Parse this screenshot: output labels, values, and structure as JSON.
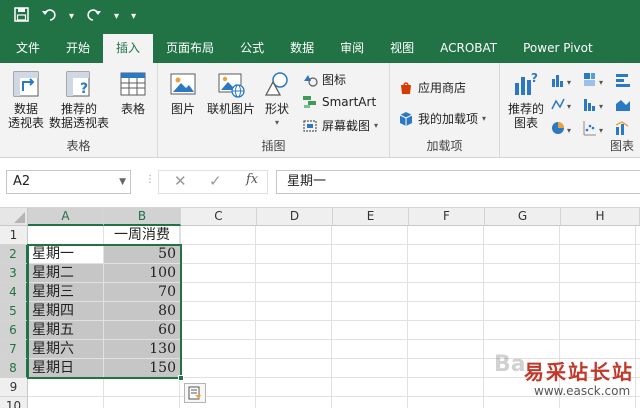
{
  "quick_access": {
    "save_icon": "save-icon",
    "undo_icon": "undo-icon",
    "redo_icon": "redo-icon",
    "customize_icon": "customize-quick-access-icon"
  },
  "tabs": [
    {
      "label": "文件",
      "active": false
    },
    {
      "label": "开始",
      "active": false
    },
    {
      "label": "插入",
      "active": true
    },
    {
      "label": "页面布局",
      "active": false
    },
    {
      "label": "公式",
      "active": false
    },
    {
      "label": "数据",
      "active": false
    },
    {
      "label": "审阅",
      "active": false
    },
    {
      "label": "视图",
      "active": false
    },
    {
      "label": "ACROBAT",
      "active": false
    },
    {
      "label": "Power Pivot",
      "active": false
    }
  ],
  "ribbon": {
    "tables": {
      "label": "表格",
      "pivot_table": {
        "line1": "数据",
        "line2": "透视表"
      },
      "recommended_pivot": {
        "line1": "推荐的",
        "line2": "数据透视表"
      },
      "table": {
        "line1": "表格"
      }
    },
    "illustrations": {
      "label": "插图",
      "picture": "图片",
      "online_picture": "联机图片",
      "shapes": "形状",
      "icons": "图标",
      "smartart": "SmartArt",
      "screenshot": "屏幕截图"
    },
    "addins": {
      "label": "加载项",
      "store": "应用商店",
      "my_addins": "我的加载项"
    },
    "charts": {
      "label": "图表",
      "recommended": {
        "line1": "推荐的",
        "line2": "图表"
      }
    }
  },
  "formula_bar": {
    "name_box": "A2",
    "cancel_glyph": "✕",
    "enter_glyph": "✓",
    "fx_label": "fx",
    "formula": "星期一"
  },
  "columns": [
    "A",
    "B",
    "C",
    "D",
    "E",
    "F",
    "G",
    "H"
  ],
  "rows": [
    "1",
    "2",
    "3",
    "4",
    "5",
    "6",
    "7",
    "8",
    "9",
    "10"
  ],
  "sheet": {
    "header_b": "一周消费",
    "data": [
      {
        "day": "星期一",
        "amount": "50"
      },
      {
        "day": "星期二",
        "amount": "100"
      },
      {
        "day": "星期三",
        "amount": "70"
      },
      {
        "day": "星期四",
        "amount": "80"
      },
      {
        "day": "星期五",
        "amount": "60"
      },
      {
        "day": "星期六",
        "amount": "130"
      },
      {
        "day": "星期日",
        "amount": "150"
      }
    ]
  },
  "watermark": {
    "text": "易采站长站",
    "url": "www.easck.com"
  },
  "colors": {
    "accent": "#217346",
    "selection": "#c6c6c6"
  }
}
